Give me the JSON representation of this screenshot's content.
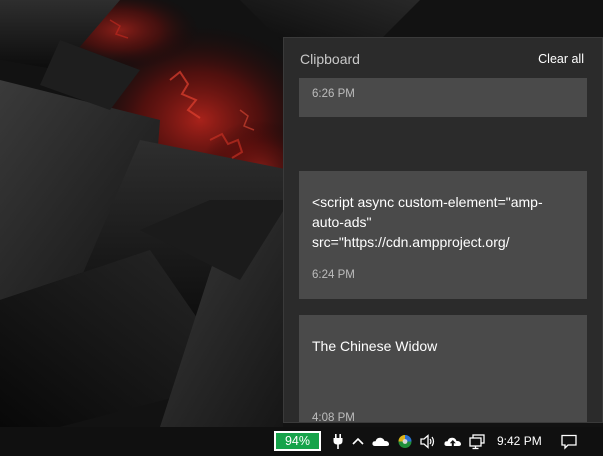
{
  "clipboard": {
    "title": "Clipboard",
    "clear_all_label": "Clear all",
    "items": [
      {
        "text": "",
        "time": "6:26 PM"
      },
      {
        "text": "<script async custom-element=\"amp-auto-ads\" src=\"https://cdn.ampproject.org/",
        "time": "6:24 PM"
      },
      {
        "text": "The Chinese Widow",
        "time": "4:08 PM"
      }
    ]
  },
  "taskbar": {
    "battery_percent": "94%",
    "clock": "9:42 PM",
    "tray_icons": [
      "power-plug-icon",
      "chevron-up-icon",
      "onedrive-cloud-icon",
      "colorful-app-icon",
      "speaker-icon",
      "cloud-upload-icon",
      "network-icon",
      "notification-icon"
    ]
  },
  "colors": {
    "flyout_bg": "#2b2b2b",
    "card_bg": "#4a4a4a",
    "battery_green": "#16a34a",
    "taskbar_bg": "#101010"
  }
}
